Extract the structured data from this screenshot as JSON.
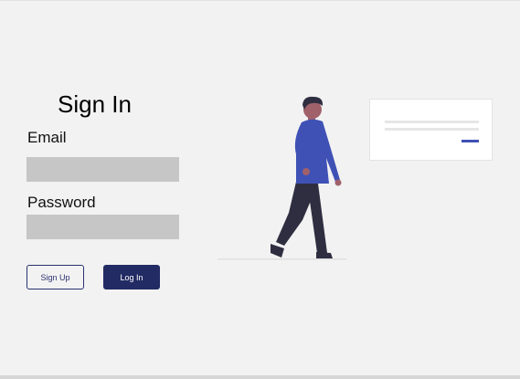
{
  "form": {
    "title": "Sign In",
    "email_label": "Email",
    "email_value": "",
    "password_label": "Password",
    "password_value": "",
    "signup_label": "Sign Up",
    "login_label": "Log In"
  },
  "illustration": {
    "figure": "walking-person-icon",
    "card": "placeholder-card"
  },
  "colors": {
    "background": "#f2f2f2",
    "input_fill": "#c6c6c6",
    "primary": "#222b63",
    "shirt": "#3f51b5",
    "accent": "#3f51b5"
  }
}
